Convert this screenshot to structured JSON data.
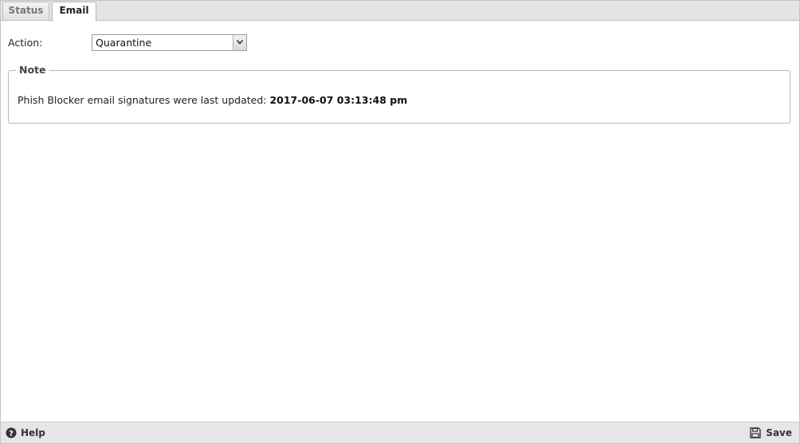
{
  "tabs": [
    {
      "label": "Status",
      "active": false
    },
    {
      "label": "Email",
      "active": true
    }
  ],
  "form": {
    "action_label": "Action:",
    "action_value": "Quarantine"
  },
  "note": {
    "legend": "Note",
    "text": "Phish Blocker email signatures were last updated:",
    "date": "2017-06-07 03:13:48 pm"
  },
  "footer": {
    "help_label": "Help",
    "save_label": "Save",
    "help_icon": "help-circle-icon",
    "save_icon": "floppy-disk-icon"
  }
}
